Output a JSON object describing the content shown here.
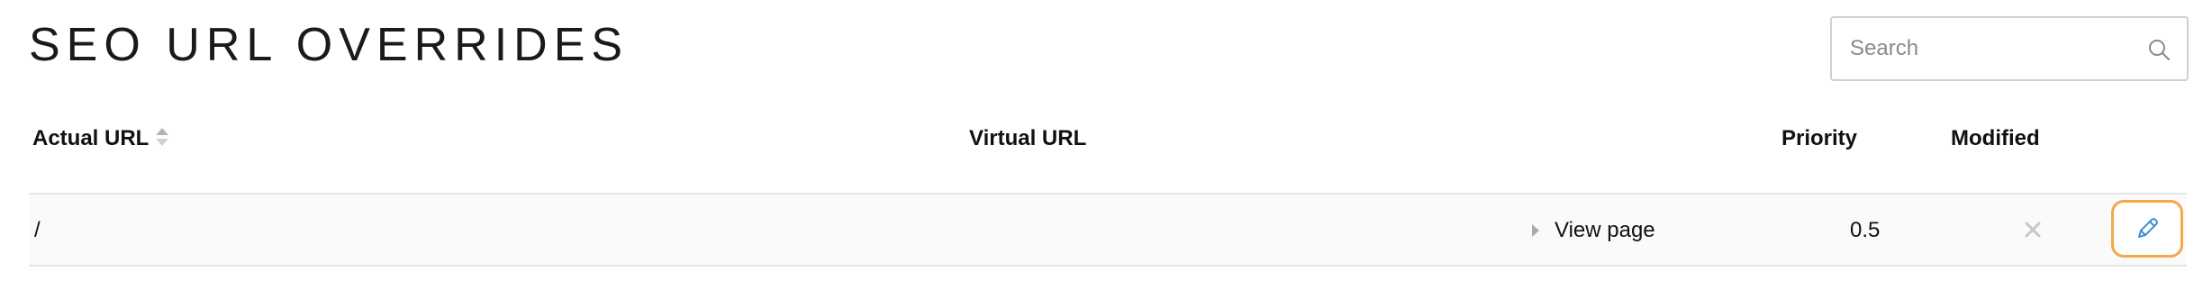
{
  "page": {
    "title": "SEO URL OVERRIDES"
  },
  "search": {
    "placeholder": "Search",
    "value": "",
    "icon": "search-icon"
  },
  "table": {
    "columns": [
      {
        "label": "Actual URL",
        "sortable": true,
        "sort_icon": "sort-icon"
      },
      {
        "label": "Virtual URL"
      },
      {
        "label": "Priority"
      },
      {
        "label": "Modified"
      }
    ],
    "rows": [
      {
        "actual_url": "/",
        "virtual_url": "",
        "view_page_label": "View page",
        "priority": "0.5",
        "modified": "",
        "actions": [
          "delete-icon",
          "edit-icon"
        ]
      }
    ]
  },
  "colors": {
    "edit_button_border": "#f4a84a",
    "edit_icon": "#3a8fd6",
    "row_background": "#fafafa",
    "muted_icon": "#c8c8c8"
  }
}
